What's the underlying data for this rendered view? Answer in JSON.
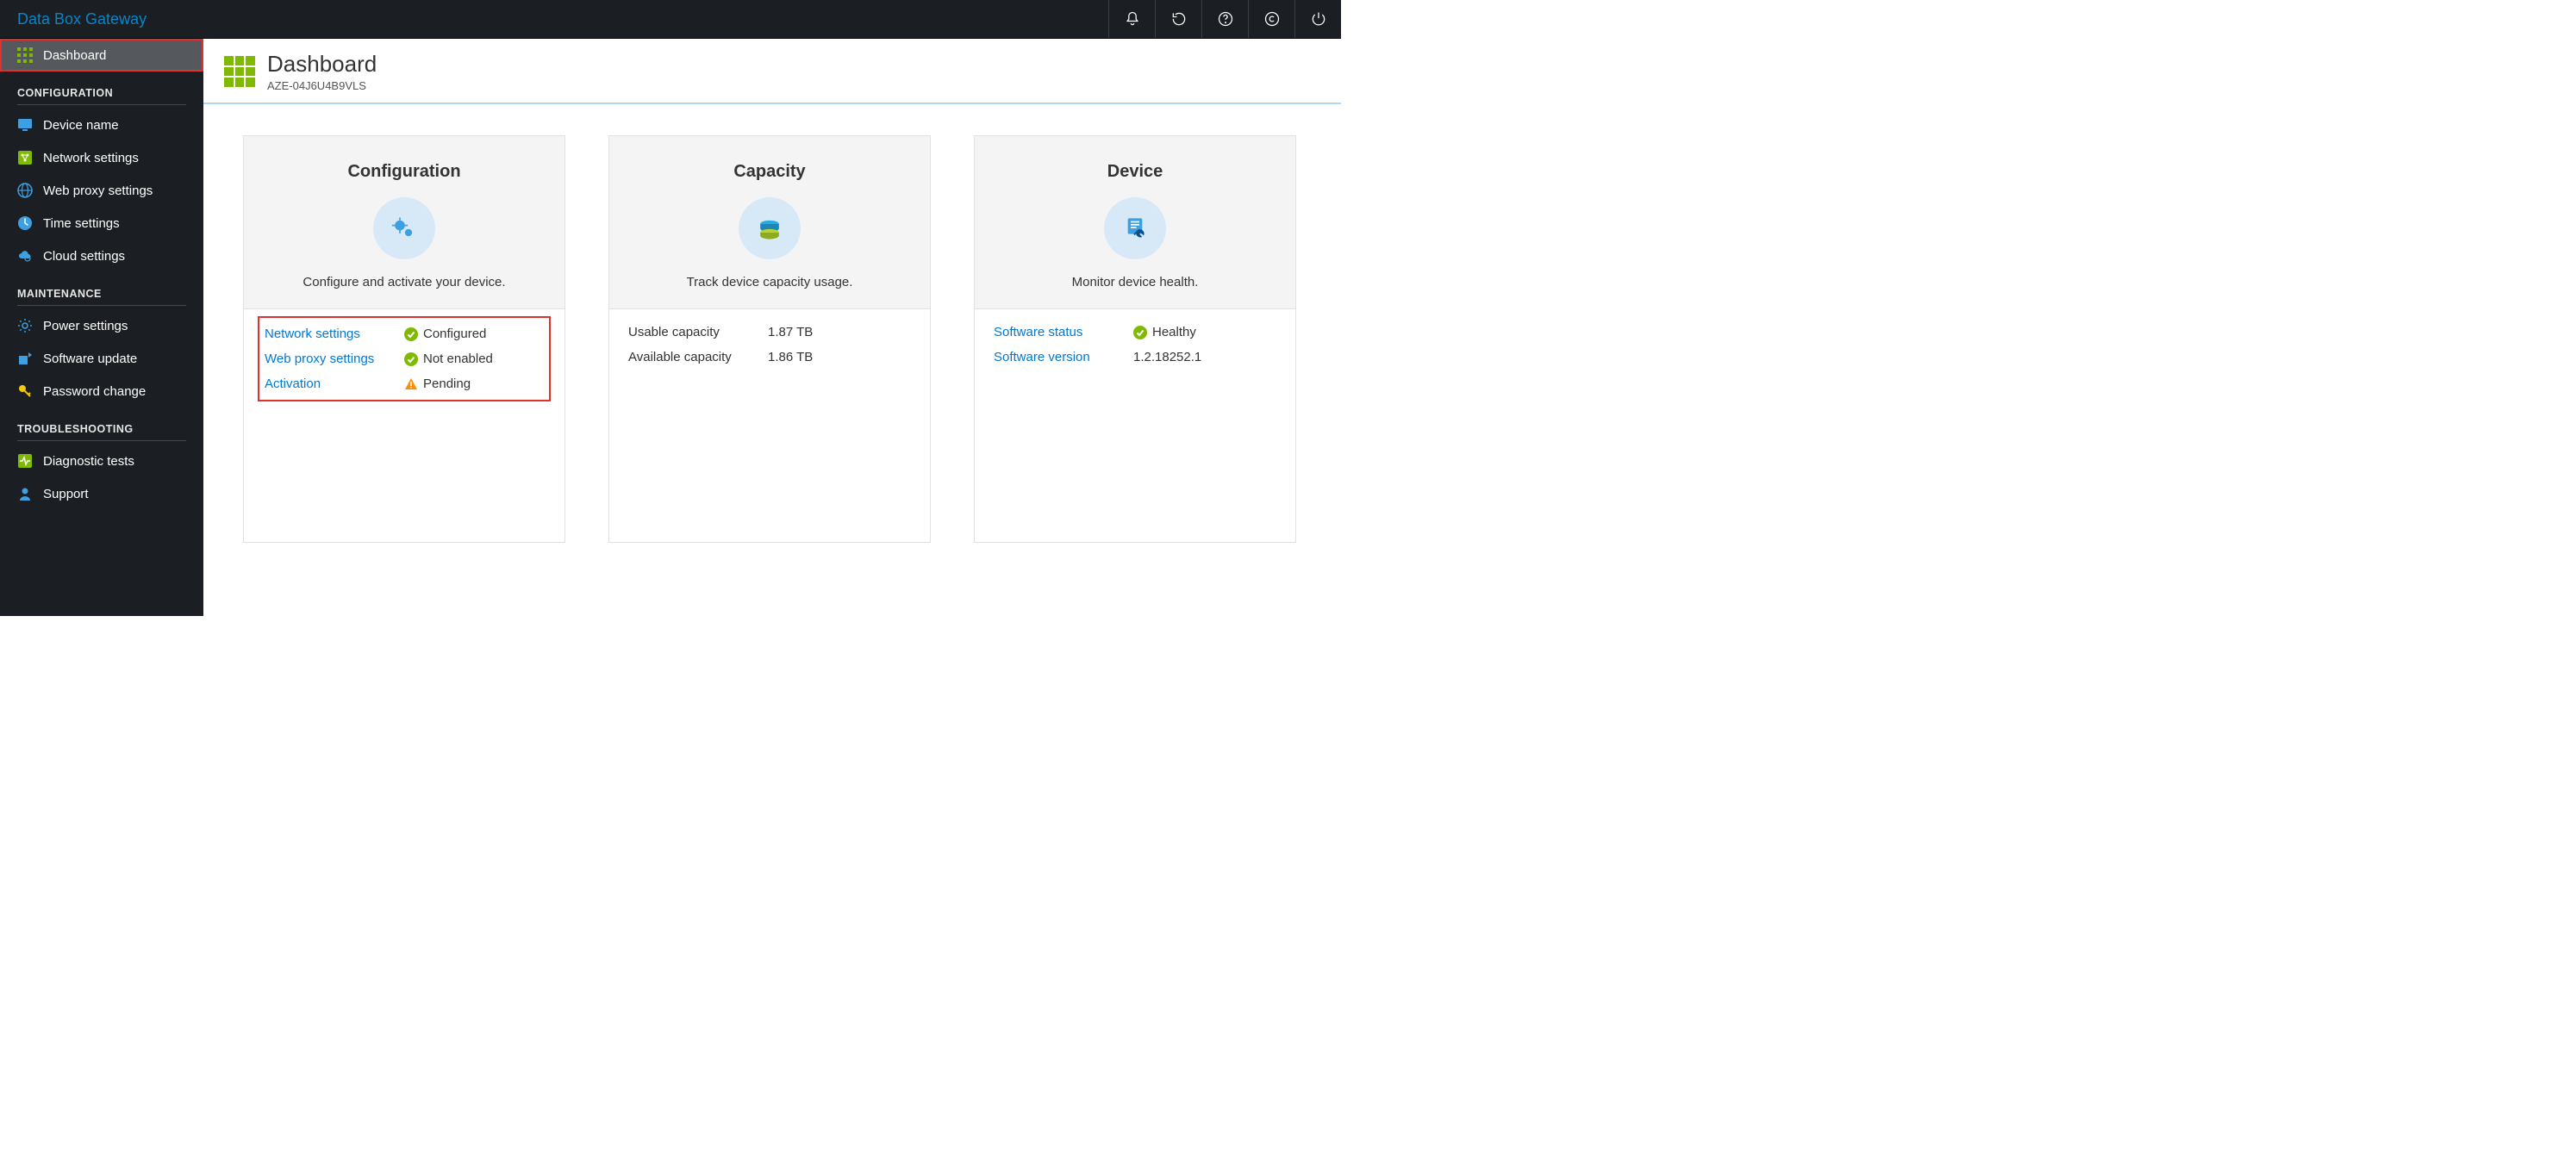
{
  "app_title": "Data Box Gateway",
  "page": {
    "title": "Dashboard",
    "subtitle": "AZE-04J6U4B9VLS"
  },
  "sidebar": {
    "items": {
      "dashboard": "Dashboard"
    },
    "sections": {
      "configuration": {
        "label": "CONFIGURATION",
        "items": {
          "device_name": "Device name",
          "network_settings": "Network settings",
          "web_proxy": "Web proxy settings",
          "time_settings": "Time settings",
          "cloud_settings": "Cloud settings"
        }
      },
      "maintenance": {
        "label": "MAINTENANCE",
        "items": {
          "power_settings": "Power settings",
          "software_update": "Software update",
          "password_change": "Password change"
        }
      },
      "troubleshooting": {
        "label": "TROUBLESHOOTING",
        "items": {
          "diagnostic_tests": "Diagnostic tests",
          "support": "Support"
        }
      }
    }
  },
  "cards": {
    "configuration": {
      "title": "Configuration",
      "desc": "Configure and activate your device.",
      "rows": {
        "network": {
          "label": "Network settings",
          "status": "Configured"
        },
        "webproxy": {
          "label": "Web proxy settings",
          "status": "Not enabled"
        },
        "activation": {
          "label": "Activation",
          "status": "Pending"
        }
      }
    },
    "capacity": {
      "title": "Capacity",
      "desc": "Track device capacity usage.",
      "rows": {
        "usable": {
          "label": "Usable capacity",
          "value": "1.87 TB"
        },
        "available": {
          "label": "Available capacity",
          "value": "1.86 TB"
        }
      }
    },
    "device": {
      "title": "Device",
      "desc": "Monitor device health.",
      "rows": {
        "sw_status": {
          "label": "Software status",
          "value": "Healthy"
        },
        "sw_version": {
          "label": "Software version",
          "value": "1.2.18252.1"
        }
      }
    }
  }
}
